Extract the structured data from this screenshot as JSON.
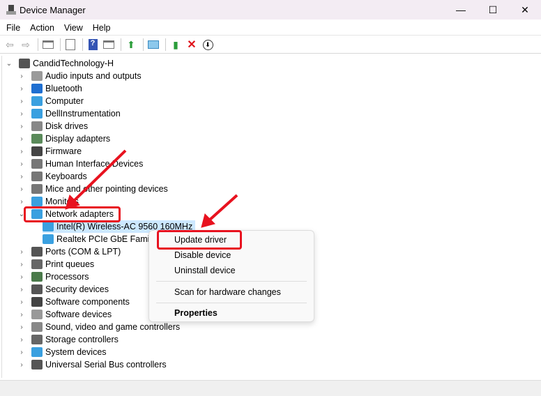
{
  "window": {
    "title": "Device Manager",
    "minimize": "—",
    "maximize": "☐",
    "close": "✕"
  },
  "menu": [
    "File",
    "Action",
    "View",
    "Help"
  ],
  "toolbar": [
    "back-icon",
    "forward-icon",
    "show-hide-console-tree-icon",
    "properties-icon",
    "help-icon",
    "action-pane-icon",
    "update-driver-icon",
    "scan-hardware-icon",
    "add-driver-icon",
    "uninstall-icon",
    "disable-icon"
  ],
  "tree": {
    "root": "CandidTechnology-H",
    "categories": [
      {
        "label": "Audio inputs and outputs",
        "color": "#9a9a9a"
      },
      {
        "label": "Bluetooth",
        "color": "#1f6fd1"
      },
      {
        "label": "Computer",
        "color": "#3aa0e0"
      },
      {
        "label": "DellInstrumentation",
        "color": "#3aa0e0"
      },
      {
        "label": "Disk drives",
        "color": "#888"
      },
      {
        "label": "Display adapters",
        "color": "#5a8a5a"
      },
      {
        "label": "Firmware",
        "color": "#444"
      },
      {
        "label": "Human Interface Devices",
        "color": "#777"
      },
      {
        "label": "Keyboards",
        "color": "#777"
      },
      {
        "label": "Mice and other pointing devices",
        "color": "#777"
      },
      {
        "label": "Monitors",
        "color": "#3aa0e0"
      },
      {
        "label": "Network adapters",
        "color": "#3aa0e0",
        "expanded": true,
        "children": [
          "Intel(R) Wireless-AC 9560 160MHz",
          "Realtek PCIe GbE Family"
        ]
      },
      {
        "label": "Ports (COM & LPT)",
        "color": "#555"
      },
      {
        "label": "Print queues",
        "color": "#666"
      },
      {
        "label": "Processors",
        "color": "#4a7a4a"
      },
      {
        "label": "Security devices",
        "color": "#555"
      },
      {
        "label": "Software components",
        "color": "#444"
      },
      {
        "label": "Software devices",
        "color": "#999"
      },
      {
        "label": "Sound, video and game controllers",
        "color": "#888"
      },
      {
        "label": "Storage controllers",
        "color": "#666"
      },
      {
        "label": "System devices",
        "color": "#3aa0e0"
      },
      {
        "label": "Universal Serial Bus controllers",
        "color": "#555"
      }
    ],
    "selected": "Intel(R) Wireless-AC 9560 160MHz"
  },
  "context_menu": {
    "update": "Update driver",
    "disable": "Disable device",
    "uninstall": "Uninstall device",
    "scan": "Scan for hardware changes",
    "properties": "Properties"
  },
  "colors": {
    "annotation": "#e8121f",
    "selection": "#cce8ff"
  }
}
